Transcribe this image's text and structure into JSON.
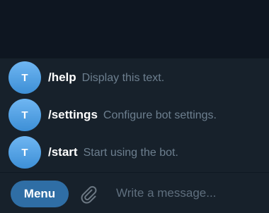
{
  "commands": [
    {
      "avatar_letter": "T",
      "name": "/help",
      "description": "Display this text."
    },
    {
      "avatar_letter": "T",
      "name": "/settings",
      "description": "Configure bot settings."
    },
    {
      "avatar_letter": "T",
      "name": "/start",
      "description": "Start using the bot."
    }
  ],
  "input_bar": {
    "menu_label": "Menu",
    "attach_icon": "paperclip-icon",
    "placeholder": "Write a message..."
  },
  "colors": {
    "chat_background": "#0e1621",
    "panel_background": "#17212b",
    "menu_button": "#2f6ea5",
    "avatar": "#4f9fe3",
    "command_name": "#ffffff",
    "command_description": "#6d7f8f"
  }
}
